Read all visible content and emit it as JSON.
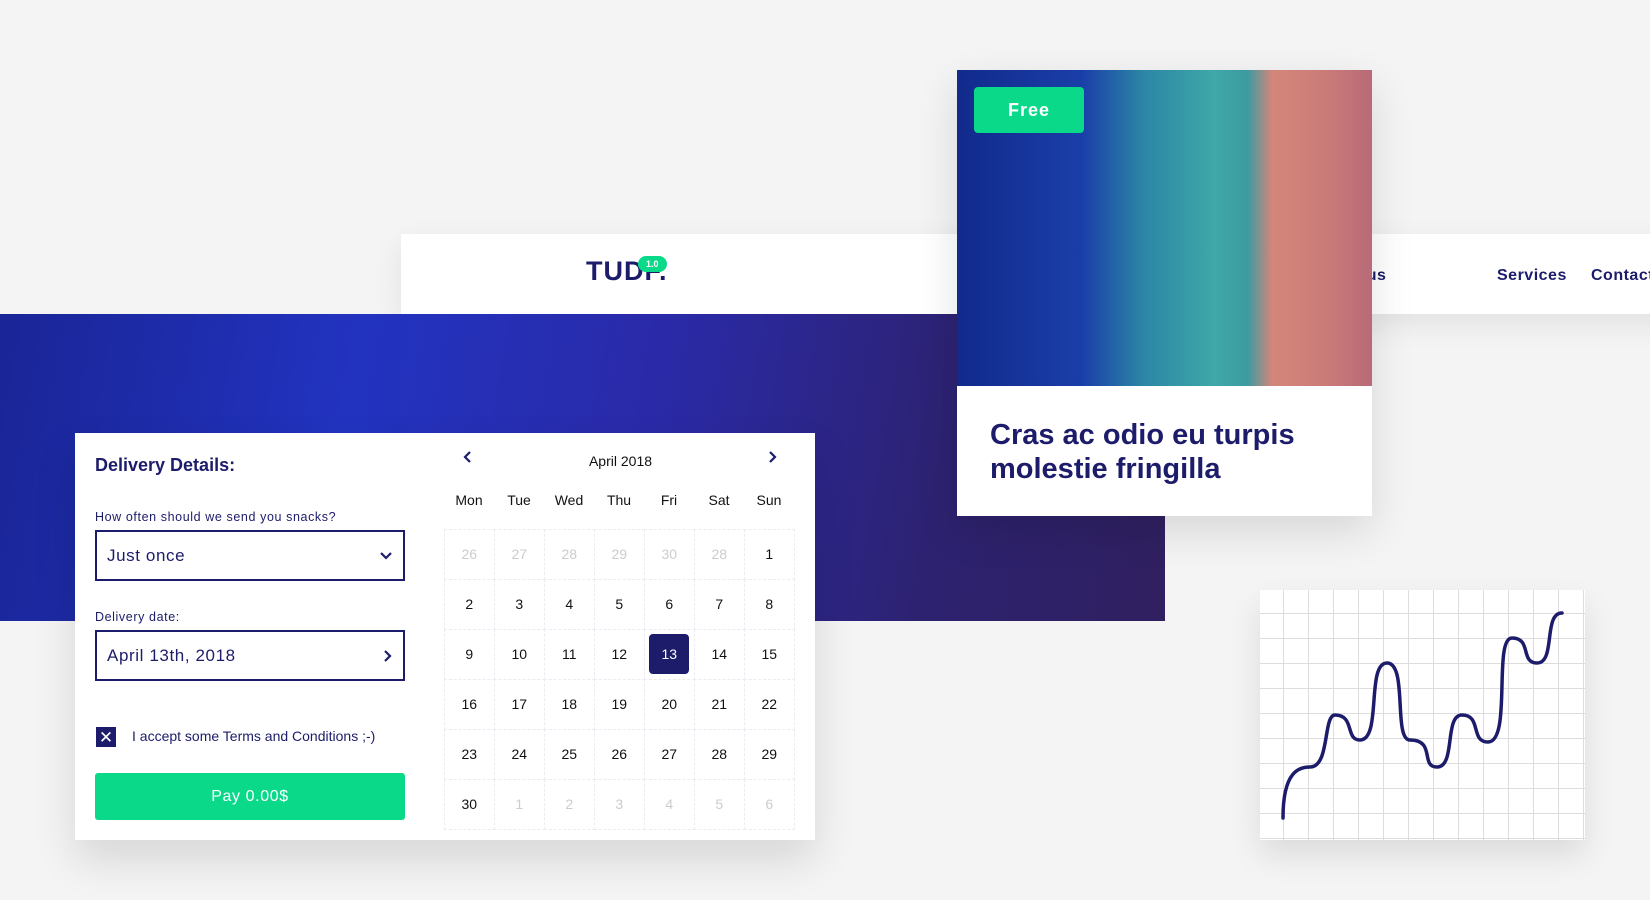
{
  "header": {
    "logo": "TUDF.",
    "version": "1.0",
    "nav": [
      "t us",
      "Services",
      "Contact"
    ]
  },
  "card": {
    "badge": "Free",
    "title": "Cras ac odio eu turpis molestie fringilla"
  },
  "form": {
    "title": "Delivery Details:",
    "frequency_label": "How often should we send you snacks?",
    "frequency_value": "Just once",
    "date_label": "Delivery date:",
    "date_value": "April 13th, 2018",
    "terms_label": "I accept some Terms and Conditions ;-)",
    "terms_checked": true,
    "pay_label": "Pay 0.00$"
  },
  "calendar": {
    "month": "April 2018",
    "weekdays": [
      "Mon",
      "Tue",
      "Wed",
      "Thu",
      "Fri",
      "Sat",
      "Sun"
    ],
    "days": [
      {
        "d": "26",
        "out": true
      },
      {
        "d": "27",
        "out": true
      },
      {
        "d": "28",
        "out": true
      },
      {
        "d": "29",
        "out": true
      },
      {
        "d": "30",
        "out": true
      },
      {
        "d": "28",
        "out": true
      },
      {
        "d": "1"
      },
      {
        "d": "2"
      },
      {
        "d": "3"
      },
      {
        "d": "4"
      },
      {
        "d": "5"
      },
      {
        "d": "6"
      },
      {
        "d": "7"
      },
      {
        "d": "8"
      },
      {
        "d": "9"
      },
      {
        "d": "10"
      },
      {
        "d": "11"
      },
      {
        "d": "12"
      },
      {
        "d": "13",
        "selected": true
      },
      {
        "d": "14"
      },
      {
        "d": "15"
      },
      {
        "d": "16"
      },
      {
        "d": "17"
      },
      {
        "d": "18"
      },
      {
        "d": "19"
      },
      {
        "d": "20"
      },
      {
        "d": "21"
      },
      {
        "d": "22"
      },
      {
        "d": "23"
      },
      {
        "d": "24"
      },
      {
        "d": "25"
      },
      {
        "d": "26"
      },
      {
        "d": "27"
      },
      {
        "d": "28"
      },
      {
        "d": "29"
      },
      {
        "d": "30"
      },
      {
        "d": "1",
        "out": true
      },
      {
        "d": "2",
        "out": true
      },
      {
        "d": "3",
        "out": true
      },
      {
        "d": "4",
        "out": true
      },
      {
        "d": "5",
        "out": true
      },
      {
        "d": "6",
        "out": true
      }
    ]
  },
  "colors": {
    "navy": "#1c1c6b",
    "green": "#0bd98a"
  }
}
